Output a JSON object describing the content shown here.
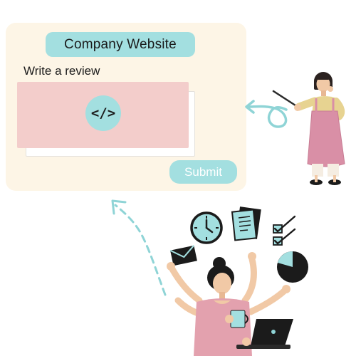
{
  "form": {
    "title": "Company Website",
    "review_label": "Write a review",
    "code_icon": "</>",
    "submit_label": "Submit"
  },
  "illustrations": {
    "presenter": "woman-with-pointer-illustration",
    "multitasker": "multitasking-woman-illustration"
  },
  "colors": {
    "card_bg": "#fdf5e6",
    "accent_teal": "#a3dfe0",
    "textarea_pink": "#f3cdcb",
    "dress_pink": "#d98fa6",
    "dark": "#1b1b1b"
  }
}
